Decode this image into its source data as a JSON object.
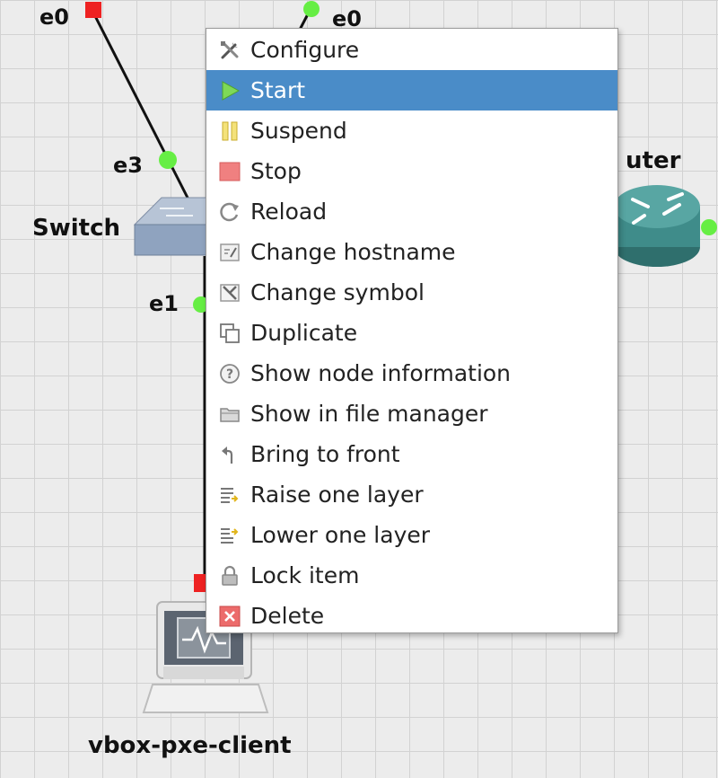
{
  "canvas": {
    "port_labels": {
      "switch_top_port": "e0",
      "top_right_port": "e0",
      "switch_e3": "e3",
      "switch_e1": "e1"
    },
    "nodes": {
      "switch": {
        "label": "Switch",
        "icon": "switch-icon"
      },
      "router": {
        "label": "uter",
        "icon": "router-icon"
      },
      "client": {
        "label": "vbox-pxe-client",
        "icon": "vm-host-icon"
      }
    },
    "colors": {
      "port_started": "#66ee44",
      "port_stopped": "#ee2222",
      "link": "#111111",
      "router": "#3f8c8a",
      "switch": "#8fa3bf"
    }
  },
  "context_menu": {
    "highlight_color": "#4a8cc8",
    "items": [
      {
        "label": "Configure",
        "icon": "wrench-screwdriver-icon",
        "highlighted": false
      },
      {
        "label": "Start",
        "icon": "play-icon",
        "highlighted": true
      },
      {
        "label": "Suspend",
        "icon": "pause-icon",
        "highlighted": false
      },
      {
        "label": "Stop",
        "icon": "stop-icon",
        "highlighted": false
      },
      {
        "label": "Reload",
        "icon": "reload-icon",
        "highlighted": false
      },
      {
        "label": "Change hostname",
        "icon": "rename-icon",
        "highlighted": false
      },
      {
        "label": "Change symbol",
        "icon": "symbol-icon",
        "highlighted": false
      },
      {
        "label": "Duplicate",
        "icon": "duplicate-icon",
        "highlighted": false
      },
      {
        "label": "Show node information",
        "icon": "info-icon",
        "highlighted": false
      },
      {
        "label": "Show in file manager",
        "icon": "folder-icon",
        "highlighted": false
      },
      {
        "label": "Bring to front",
        "icon": "bring-to-front-icon",
        "highlighted": false
      },
      {
        "label": "Raise one layer",
        "icon": "raise-layer-icon",
        "highlighted": false
      },
      {
        "label": "Lower one layer",
        "icon": "lower-layer-icon",
        "highlighted": false
      },
      {
        "label": "Lock item",
        "icon": "lock-icon",
        "highlighted": false
      },
      {
        "label": "Delete",
        "icon": "delete-icon",
        "highlighted": false
      }
    ]
  }
}
